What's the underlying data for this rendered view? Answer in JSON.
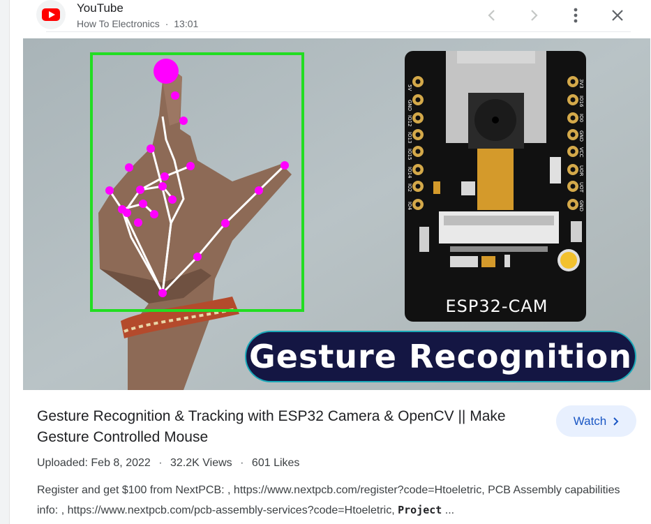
{
  "header": {
    "source_name": "YouTube",
    "channel": "How To Electronics",
    "time": "13:01",
    "separator": "·",
    "icons": {
      "logo": "youtube-logo-icon",
      "prev": "chevron-left-icon",
      "next": "chevron-right-icon",
      "more": "more-vert-icon",
      "close": "close-icon"
    }
  },
  "thumbnail": {
    "overlay_title": "Gesture Recognition",
    "board_label": "ESP32-CAM",
    "pin_labels_left": [
      "5V",
      "GND",
      "IO12",
      "IO13",
      "IO15",
      "IO14",
      "IO2",
      "IO4"
    ],
    "pin_labels_right": [
      "3V3",
      "IO16",
      "IO0",
      "GND",
      "VCC",
      "UOR",
      "UOT",
      "GND"
    ],
    "colors": {
      "bounding_box": "#22dd22",
      "landmarks": "#ff00ff",
      "overlay_bg": "#141643",
      "board": "#111111"
    }
  },
  "video": {
    "title": "Gesture Recognition & Tracking with ESP32 Camera & OpenCV || Make Gesture Controlled Mouse",
    "watch_label": "Watch",
    "uploaded": "Uploaded: Feb 8, 2022",
    "views": "32.2K Views",
    "likes": "601 Likes",
    "separator": "·",
    "description_text": "Register and get $100 from NextPCB: , https://www.nextpcb.com/register?code=Htoeletric, PCB Assembly capabilities info: , https://www.nextpcb.com/pcb-assembly-services?code=Htoeletric, ",
    "description_bold": "Project",
    "description_ellipsis": " ..."
  },
  "colors": {
    "accent": "#1a57c4",
    "watch_bg": "#e8f0fe"
  }
}
